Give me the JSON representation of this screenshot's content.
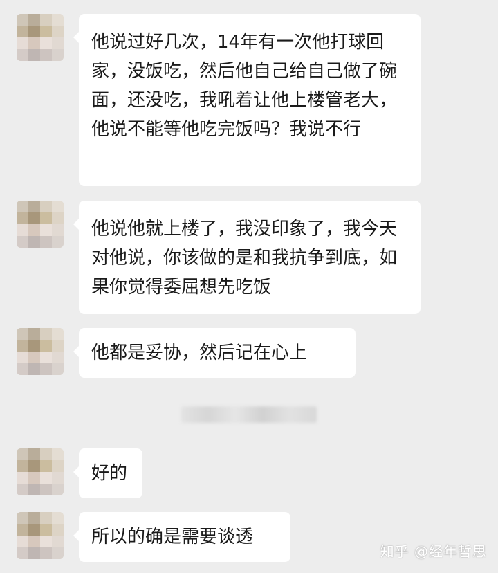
{
  "messages": [
    {
      "text": "他说过好几次，14年有一次他打球回家，没饭吃，然后他自己给自己做了碗面，还没吃，我吼着让他上楼管老大，他说不能等他吃完饭吗？我说不行"
    },
    {
      "text": "他说他就上楼了，我没印象了，我今天对他说，你该做的是和我抗争到底，如果你觉得委屈想先吃饭"
    },
    {
      "text": "他都是妥协，然后记在心上"
    },
    {
      "text": "好的"
    },
    {
      "text": "所以的确是需要谈透"
    }
  ],
  "watermark": "知乎 @经年哲思",
  "colors": {
    "background": "#ededed",
    "bubble": "#ffffff",
    "text": "#1a1a1a"
  }
}
